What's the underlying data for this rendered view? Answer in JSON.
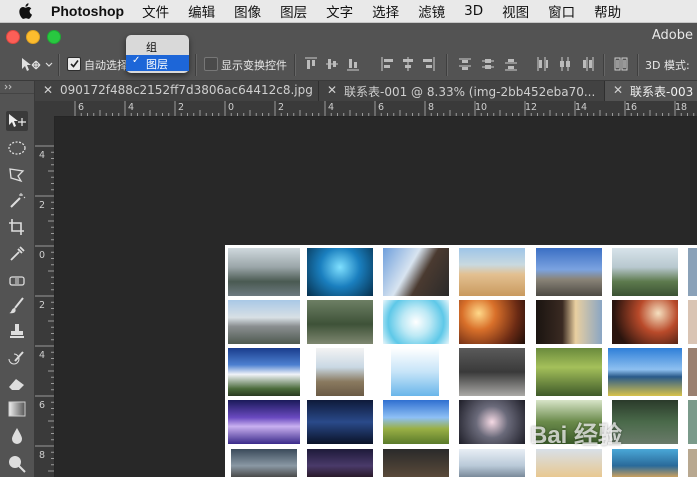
{
  "menubar": {
    "app_name": "Photoshop",
    "items": [
      "文件",
      "编辑",
      "图像",
      "图层",
      "文字",
      "选择",
      "滤镜",
      "3D",
      "视图",
      "窗口",
      "帮助"
    ]
  },
  "window": {
    "title": "Adobe"
  },
  "options": {
    "auto_select_label": "自动选择",
    "show_transform_label": "显示变换控件",
    "mode_3d_label": "3D 模式:"
  },
  "dropdown": {
    "items": [
      {
        "label": "组",
        "selected": false
      },
      {
        "label": "图层",
        "selected": true
      }
    ]
  },
  "tabs": [
    {
      "label": "090172f488c2152ff7d3806ac64412c8.jpg",
      "active": false
    },
    {
      "label": "联系表-001 @ 8.33% (img-2bb452eba70...",
      "active": false
    },
    {
      "label": "联系表-003 (",
      "active": true
    }
  ],
  "rulers": {
    "horizontal": [
      "6",
      "4",
      "2",
      "0",
      "2",
      "4",
      "6",
      "8",
      "10",
      "12",
      "14",
      "16",
      "18"
    ],
    "vertical": [
      "4",
      "2",
      "0",
      "2",
      "4",
      "6",
      "8"
    ]
  },
  "watermark": "Bai 经验",
  "colors": {
    "menubar_bg": "#e9e9e9",
    "panel_bg": "#535353",
    "canvas_bg": "#282828",
    "selection_blue": "#1d66d8"
  }
}
